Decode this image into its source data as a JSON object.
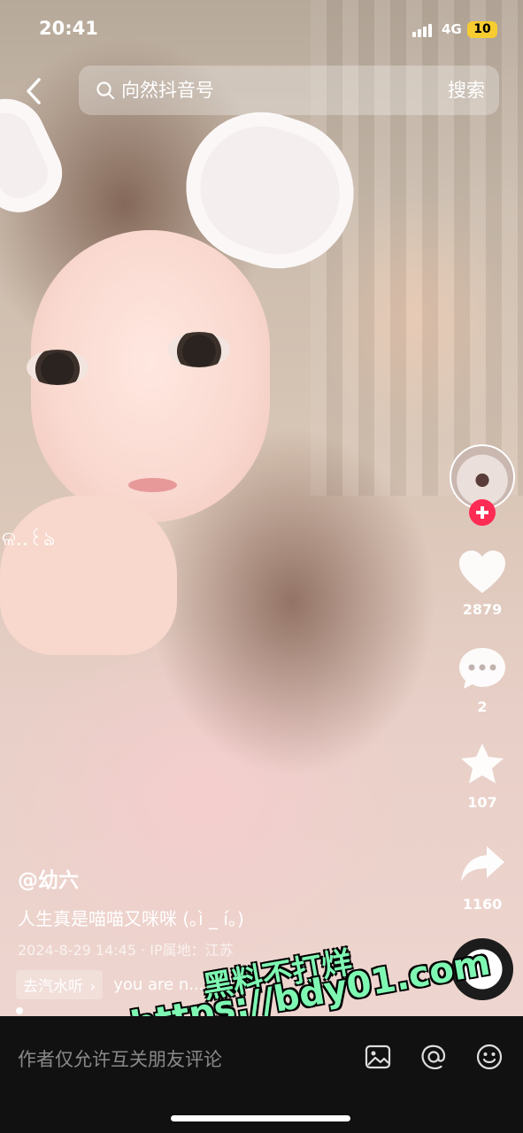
{
  "status_bar": {
    "time": "20:41",
    "network": "4G",
    "battery": "10"
  },
  "search": {
    "query": "向然抖音号",
    "button": "搜索"
  },
  "rail": {
    "likes": "2879",
    "comments": "2",
    "favorites": "107",
    "shares": "1160"
  },
  "video": {
    "author": "@幼六",
    "caption": "人生真是喵喵又咪咪 (｡ì _ í｡)",
    "meta": "2024-8-29 14:45 · IP属地：江苏",
    "tag": "去汽水听",
    "tag_arrow": "›",
    "song": "you are n... - Myc",
    "overlay_text": "ଳ..꒰ঌ"
  },
  "watermark": {
    "line1": "黑料不打烊",
    "line2": "https://bdy01.com"
  },
  "comment_bar": {
    "placeholder": "作者仅允许互关朋友评论"
  },
  "colors": {
    "follow": "#fe2c55",
    "battery": "#f7cc30",
    "watermark": "#7ef7b2"
  }
}
